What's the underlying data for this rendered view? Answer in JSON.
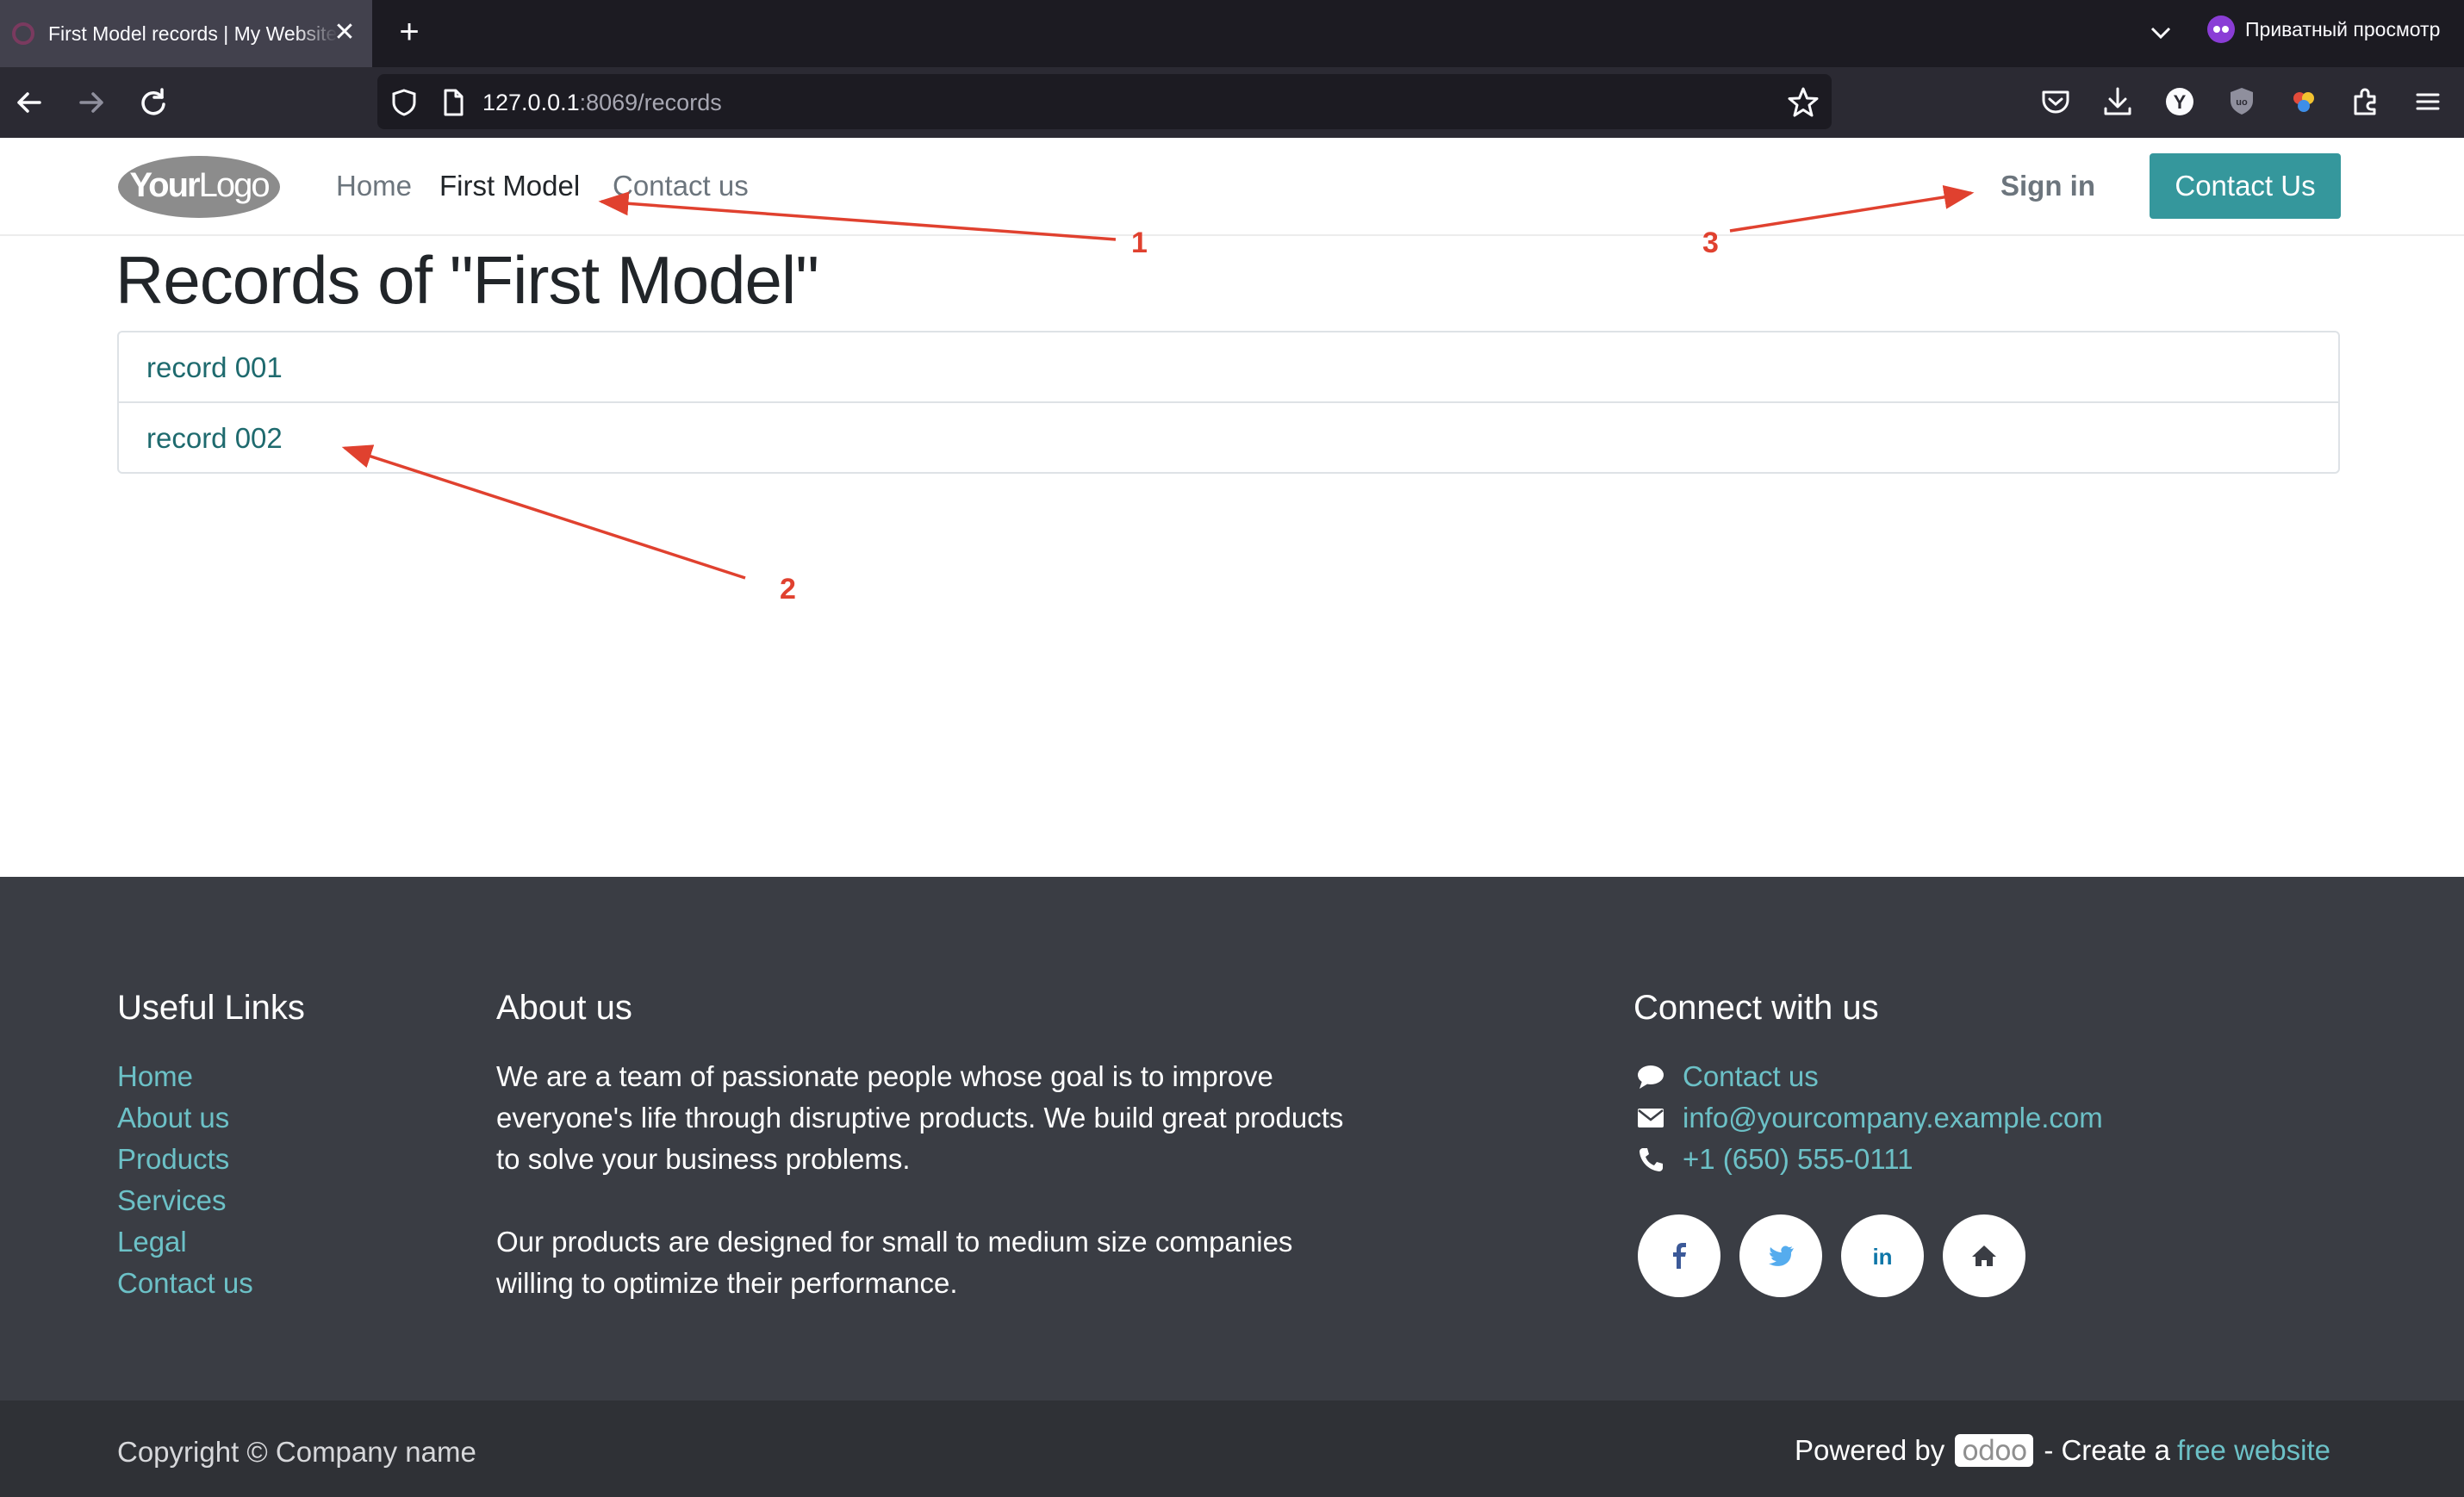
{
  "browser": {
    "tab_title": "First Model records | My Website",
    "private_label": "Приватный просмотр",
    "url_host": "127.0.0.1",
    "url_rest": ":8069/records"
  },
  "site": {
    "logo_text": "YourLogo",
    "menu": [
      "Home",
      "First Model",
      "Contact us"
    ],
    "signin_label": "Sign in",
    "contact_button": "Contact Us"
  },
  "main": {
    "title": "Records of \"First Model\"",
    "records": [
      "record 001",
      "record 002"
    ]
  },
  "annotations": [
    "1",
    "2",
    "3"
  ],
  "footer": {
    "useful_links": {
      "heading": "Useful Links",
      "links": [
        "Home",
        "About us",
        "Products",
        "Services",
        "Legal",
        "Contact us"
      ]
    },
    "about": {
      "heading": "About us",
      "lines": [
        "We are a team of passionate people whose goal is to improve",
        "everyone's life through disruptive products. We build great products",
        "to solve your business problems.",
        "Our products are designed for small to medium size companies",
        "willing to optimize their performance."
      ]
    },
    "connect": {
      "heading": "Connect with us",
      "items": [
        {
          "icon": "comment-icon",
          "text": "Contact us"
        },
        {
          "icon": "envelope-icon",
          "text": "info@yourcompany.example.com"
        },
        {
          "icon": "phone-icon",
          "text": "+1 (650) 555-0111"
        }
      ],
      "social": [
        "facebook-icon",
        "twitter-icon",
        "linkedin-icon",
        "home-icon"
      ]
    },
    "copyright": "Copyright © Company name",
    "powered_by": "Powered by",
    "odoo": "odoo",
    "create_a": "- Create a",
    "free_website": "free website"
  },
  "colors": {
    "accent": "#35979c",
    "link": "#1e6a6e",
    "footer_link": "#6cc1c7",
    "footer_bg": "#3a3d44",
    "annotation": "#e0412f"
  }
}
